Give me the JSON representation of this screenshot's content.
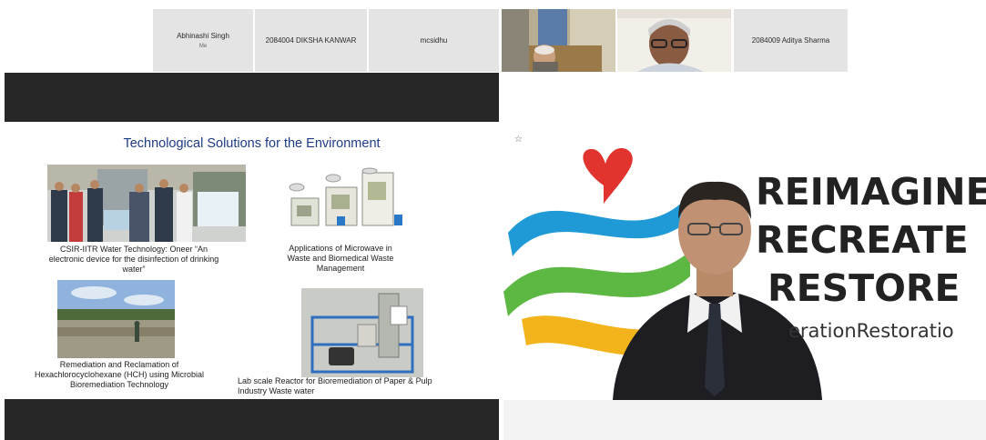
{
  "participants": [
    {
      "name": "Abhinashi Singh",
      "sub": "Me"
    },
    {
      "name": "2084004 DIKSHA KANWAR"
    },
    {
      "name": "mcsidhu"
    },
    {
      "name": "2084009 Aditya Sharma"
    }
  ],
  "video_participants": [
    "camera-participant-1",
    "camera-participant-2"
  ],
  "slide": {
    "title": "Technological Solutions for the Environment",
    "captions": {
      "water": "CSIR-IITR Water Technology: Oneer “An electronic device for the disinfection of drinking water”",
      "microwave": "Applications of Microwave in Waste and Biomedical Waste Management",
      "hch": "Remediation and Reclamation of Hexachlorocyclohexane (HCH) using Microbial Bioremediation Technology",
      "reactor": "Lab scale Reactor for Bioremediation of Paper & Pulp Industry Waste water"
    }
  },
  "speaker_background": {
    "line1": "REIMAGINE",
    "line2": "RECREATE",
    "line3": "RESTORE",
    "hashtag": "erationRestoratio"
  },
  "icons": {
    "pin": "pin-icon"
  },
  "colors": {
    "tile_bg": "#e4e4e4",
    "black_bar": "#272727",
    "slide_title": "#1e3b86",
    "heart_red": "#e2342f",
    "wave_blue": "#1f9ad6",
    "wave_green": "#5db843",
    "wave_yellow": "#f3b41b"
  }
}
